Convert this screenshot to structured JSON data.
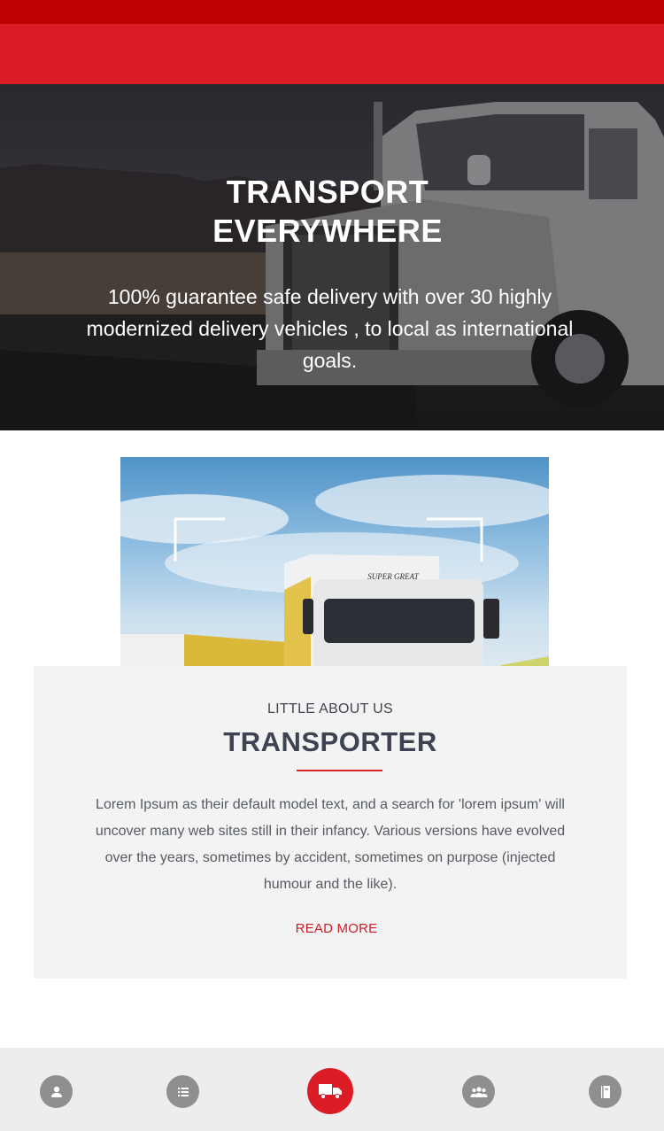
{
  "hero": {
    "title_line1": "TRANSPORT",
    "title_line2": "EVERYWHERE",
    "subtitle": "100% guarantee safe delivery  with over 30 highly modernized delivery vehicles , to local as international goals."
  },
  "promo": {
    "truck_brand": "SUPER GREAT"
  },
  "about": {
    "kicker": "LITTLE ABOUT US",
    "title": "TRANSPORTER",
    "body": "Lorem Ipsum as their default model text, and a search for 'lorem ipsum' will uncover many web sites still in their infancy. Various versions have evolved over the years, sometimes by accident, sometimes on purpose (injected humour and the like).",
    "read_more": "READ MORE"
  },
  "bottom_nav": {
    "items": [
      {
        "icon": "user-icon",
        "active": false
      },
      {
        "icon": "list-icon",
        "active": false
      },
      {
        "icon": "truck-icon",
        "active": true
      },
      {
        "icon": "group-icon",
        "active": false
      },
      {
        "icon": "book-icon",
        "active": false
      }
    ]
  },
  "colors": {
    "status_bar": "#bd0000",
    "header": "#dc1c24",
    "accent": "#dc1c24",
    "card_bg": "#f3f3f3",
    "nav_bg": "#ededed",
    "nav_icon_bg": "#8f8f8f"
  }
}
